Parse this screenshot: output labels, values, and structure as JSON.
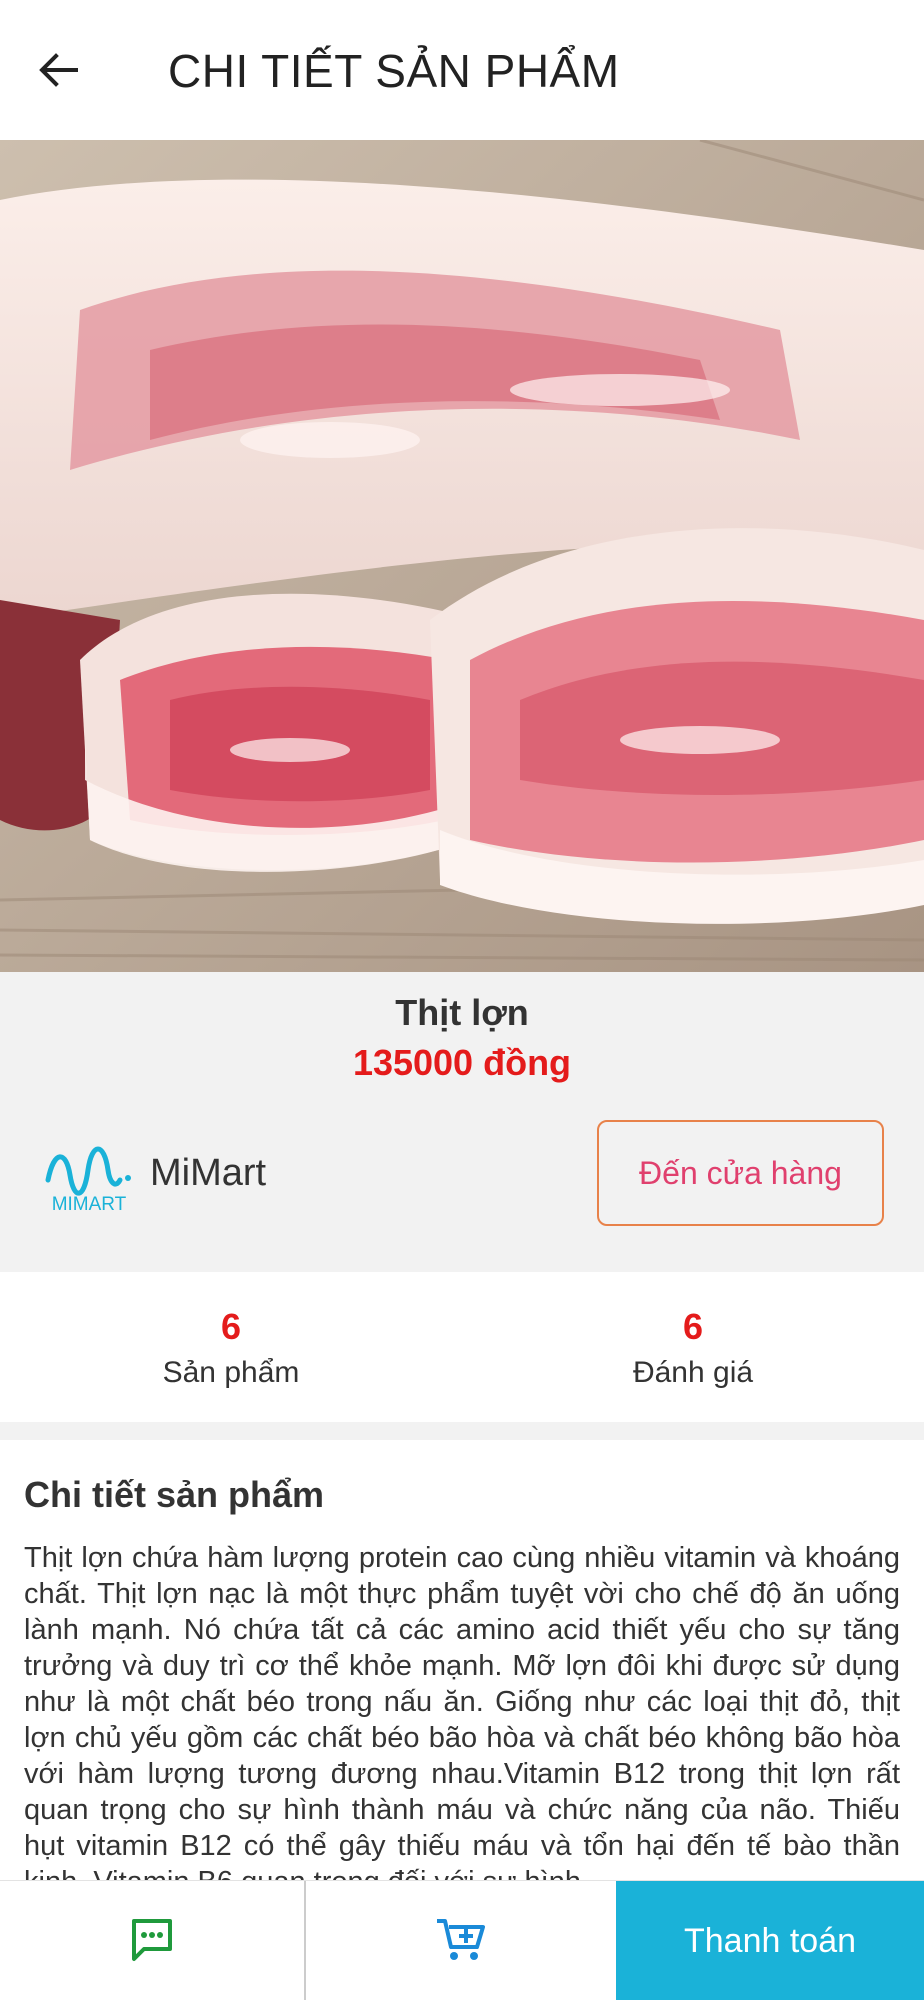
{
  "header": {
    "title": "CHI TIẾT SẢN PHẨM",
    "back_icon": "arrow-left-icon"
  },
  "product": {
    "name": "Thịt lợn",
    "price": "135000 đồng",
    "image": "pork-belly-photo"
  },
  "store": {
    "logo_text": "MIMART",
    "name": "MiMart",
    "button_label": "Đến cửa hàng"
  },
  "stats": [
    {
      "value": "6",
      "label": "Sản phẩm"
    },
    {
      "value": "6",
      "label": "Đánh giá"
    }
  ],
  "details": {
    "title": "Chi tiết sản phẩm",
    "text": "Thịt lợn chứa hàm lượng protein cao cùng nhiều vitamin và khoáng chất. Thịt lợn nạc là một thực phẩm tuyệt vời cho chế độ ăn uống lành mạnh. Nó chứa tất cả các amino acid thiết yếu cho sự tăng trưởng và duy trì cơ thể khỏe mạnh. Mỡ lợn đôi khi được sử dụng như là một chất béo trong nấu ăn. Giống như các loại thịt đỏ, thịt lợn chủ yếu gồm các chất béo bão hòa và chất béo không bão hòa với hàm lượng tương đương nhau.Vitamin B12 trong thịt lợn rất quan trọng cho sự hình thành máu và chức năng của não. Thiếu hụt vitamin B12 có thể gây thiếu máu và tổn hại đến tế bào thần kinh. Vitamin B6 quan trọng đối với sự hình"
  },
  "bottom_bar": {
    "chat_icon": "chat-icon",
    "cart_icon": "add-to-cart-icon",
    "pay_label": "Thanh toán"
  },
  "colors": {
    "accent": "#1ab2d8",
    "price": "#e41b1b",
    "store_button_border": "#e8824a",
    "store_button_text": "#e0406e",
    "icon_green": "#1f9a3c",
    "icon_blue": "#1a8ad8"
  }
}
